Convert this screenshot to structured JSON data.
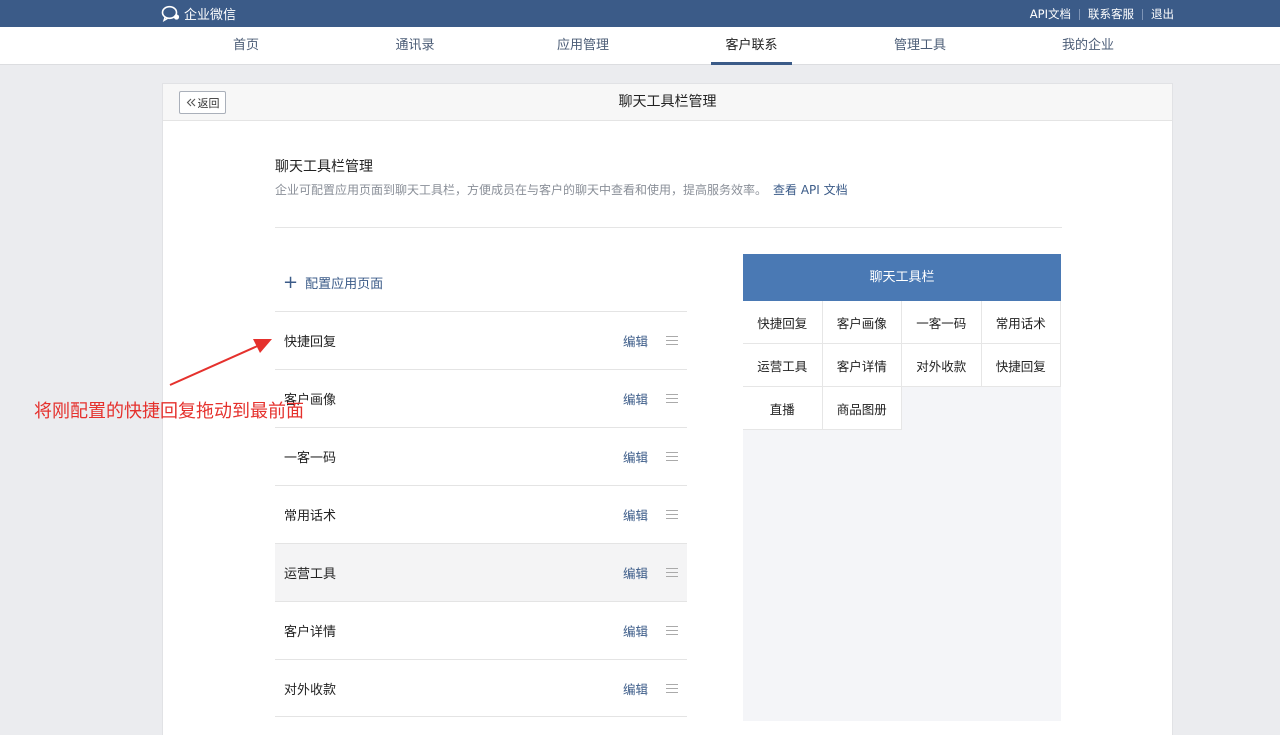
{
  "topbar": {
    "logo": "企业微信",
    "links": [
      "API文档",
      "联系客服",
      "退出"
    ]
  },
  "nav": {
    "tabs": [
      "首页",
      "通讯录",
      "应用管理",
      "客户联系",
      "管理工具",
      "我的企业"
    ],
    "active": "客户联系"
  },
  "panel": {
    "back_label": "返回",
    "title": "聊天工具栏管理"
  },
  "section": {
    "title": "聊天工具栏管理",
    "description": "企业可配置应用页面到聊天工具栏，方便成员在与客户的聊天中查看和使用，提高服务效率。",
    "api_link": "查看 API 文档",
    "add_label": "配置应用页面"
  },
  "list": {
    "edit_label": "编辑",
    "items": [
      "快捷回复",
      "客户画像",
      "一客一码",
      "常用话术",
      "运营工具",
      "客户详情",
      "对外收款"
    ]
  },
  "preview": {
    "title": "聊天工具栏",
    "cells": [
      "快捷回复",
      "客户画像",
      "一客一码",
      "常用话术",
      "运营工具",
      "客户详情",
      "对外收款",
      "快捷回复",
      "直播",
      "商品图册"
    ]
  },
  "annotation": {
    "text": "将刚配置的快捷回复拖动到最前面",
    "color": "#e5312d"
  }
}
